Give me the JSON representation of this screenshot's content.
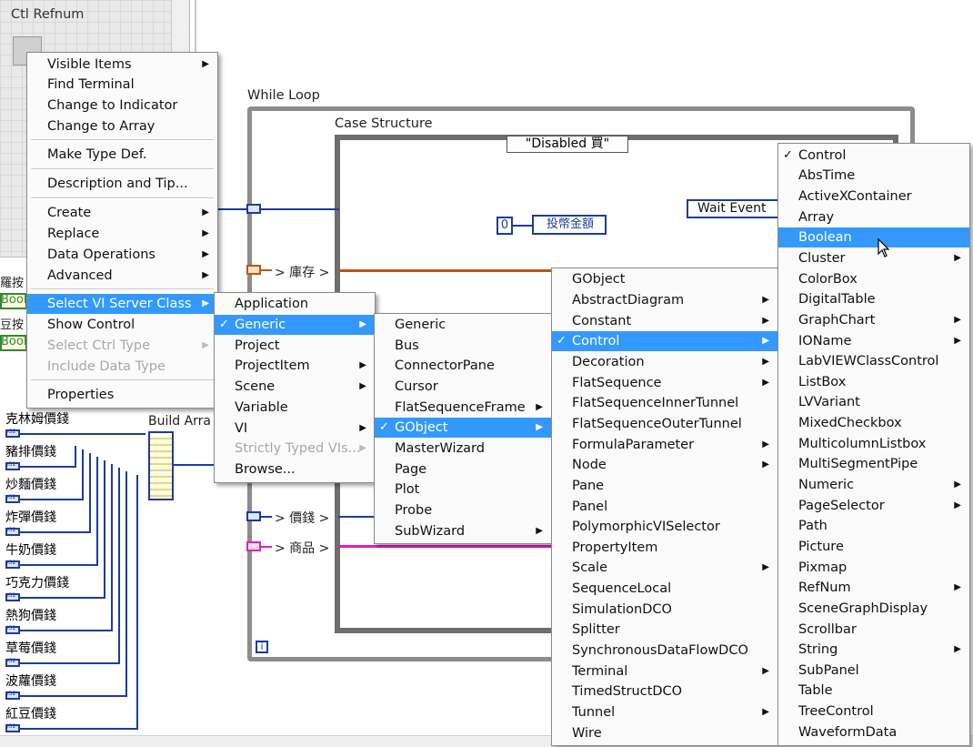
{
  "palette": {
    "title": "Ctl Refnum"
  },
  "diagram": {
    "while_loop_label": "While Loop",
    "case_structure_label": "Case Structure",
    "case_selector": "\"Disabled 買\"",
    "build_array_label": "Build Arra",
    "constant_zero": "0",
    "coin_indicator": "投幣金額",
    "wait_event": "Wait Event",
    "stock_label": "> 庫存 >",
    "price_label": "> 價錢 >",
    "product_label": "> 商品 >",
    "loop_iteration": "i",
    "left_labels": [
      "羅按",
      "Bool",
      "豆按",
      "Bool"
    ],
    "price_items": [
      "克林姆價錢",
      "豬排價錢",
      "炒麵價錢",
      "炸彈價錢",
      "牛奶價錢",
      "巧克力價錢",
      "熱狗價錢",
      "草莓價錢",
      "波蘿價錢",
      "紅豆價錢"
    ]
  },
  "menu1": {
    "items": [
      {
        "label": "Visible Items",
        "arrow": true
      },
      {
        "label": "Find Terminal"
      },
      {
        "label": "Change to Indicator"
      },
      {
        "label": "Change to Array"
      },
      {
        "label": "Make Type Def."
      },
      {
        "label": "Description and Tip..."
      },
      {
        "label": "Create",
        "arrow": true
      },
      {
        "label": "Replace",
        "arrow": true
      },
      {
        "label": "Data Operations",
        "arrow": true
      },
      {
        "label": "Advanced",
        "arrow": true
      },
      {
        "label": "Select VI Server Class",
        "arrow": true,
        "highlighted": true
      },
      {
        "label": "Show Control"
      },
      {
        "label": "Select Ctrl Type",
        "arrow": true,
        "disabled": true
      },
      {
        "label": "Include Data Type",
        "disabled": true
      },
      {
        "label": "Properties"
      }
    ]
  },
  "menu2": {
    "items": [
      {
        "label": "Application"
      },
      {
        "label": "Generic",
        "arrow": true,
        "highlighted": true,
        "checked": true
      },
      {
        "label": "Project"
      },
      {
        "label": "ProjectItem",
        "arrow": true
      },
      {
        "label": "Scene",
        "arrow": true
      },
      {
        "label": "Variable"
      },
      {
        "label": "VI",
        "arrow": true
      },
      {
        "label": "Strictly Typed VIs...",
        "arrow": true,
        "disabled": true
      },
      {
        "label": "Browse..."
      }
    ]
  },
  "menu3": {
    "items": [
      {
        "label": "Generic"
      },
      {
        "label": "Bus"
      },
      {
        "label": "ConnectorPane"
      },
      {
        "label": "Cursor"
      },
      {
        "label": "FlatSequenceFrame",
        "arrow": true
      },
      {
        "label": "GObject",
        "arrow": true,
        "highlighted": true,
        "checked": true
      },
      {
        "label": "MasterWizard"
      },
      {
        "label": "Page"
      },
      {
        "label": "Plot"
      },
      {
        "label": "Probe"
      },
      {
        "label": "SubWizard",
        "arrow": true
      }
    ]
  },
  "menu4": {
    "items": [
      {
        "label": "GObject"
      },
      {
        "label": "AbstractDiagram",
        "arrow": true
      },
      {
        "label": "Constant",
        "arrow": true
      },
      {
        "label": "Control",
        "arrow": true,
        "highlighted": true,
        "checked": true
      },
      {
        "label": "Decoration",
        "arrow": true
      },
      {
        "label": "FlatSequence",
        "arrow": true
      },
      {
        "label": "FlatSequenceInnerTunnel"
      },
      {
        "label": "FlatSequenceOuterTunnel"
      },
      {
        "label": "FormulaParameter",
        "arrow": true
      },
      {
        "label": "Node",
        "arrow": true
      },
      {
        "label": "Pane"
      },
      {
        "label": "Panel"
      },
      {
        "label": "PolymorphicVISelector"
      },
      {
        "label": "PropertyItem"
      },
      {
        "label": "Scale",
        "arrow": true
      },
      {
        "label": "SequenceLocal"
      },
      {
        "label": "SimulationDCO"
      },
      {
        "label": "Splitter"
      },
      {
        "label": "SynchronousDataFlowDCO"
      },
      {
        "label": "Terminal",
        "arrow": true
      },
      {
        "label": "TimedStructDCO"
      },
      {
        "label": "Tunnel",
        "arrow": true
      },
      {
        "label": "Wire"
      }
    ]
  },
  "menu5": {
    "items": [
      {
        "label": "Control",
        "checked": true
      },
      {
        "label": "AbsTime"
      },
      {
        "label": "ActiveXContainer"
      },
      {
        "label": "Array"
      },
      {
        "label": "Boolean",
        "highlighted": true
      },
      {
        "label": "Cluster",
        "arrow": true
      },
      {
        "label": "ColorBox"
      },
      {
        "label": "DigitalTable"
      },
      {
        "label": "GraphChart",
        "arrow": true
      },
      {
        "label": "IOName",
        "arrow": true
      },
      {
        "label": "LabVIEWClassControl"
      },
      {
        "label": "ListBox"
      },
      {
        "label": "LVVariant"
      },
      {
        "label": "MixedCheckbox"
      },
      {
        "label": "MulticolumnListbox"
      },
      {
        "label": "MultiSegmentPipe"
      },
      {
        "label": "Numeric",
        "arrow": true
      },
      {
        "label": "PageSelector",
        "arrow": true
      },
      {
        "label": "Path"
      },
      {
        "label": "Picture"
      },
      {
        "label": "Pixmap"
      },
      {
        "label": "RefNum",
        "arrow": true
      },
      {
        "label": "SceneGraphDisplay"
      },
      {
        "label": "Scrollbar"
      },
      {
        "label": "String",
        "arrow": true
      },
      {
        "label": "SubPanel"
      },
      {
        "label": "Table"
      },
      {
        "label": "TreeControl"
      },
      {
        "label": "WaveformData"
      }
    ]
  },
  "colors": {
    "highlight": "#3399ff",
    "wire_blue": "#1e3c9a",
    "wire_orange": "#b45a14",
    "wire_pink": "#e020c0",
    "bool_green": "#2f8a2f"
  }
}
